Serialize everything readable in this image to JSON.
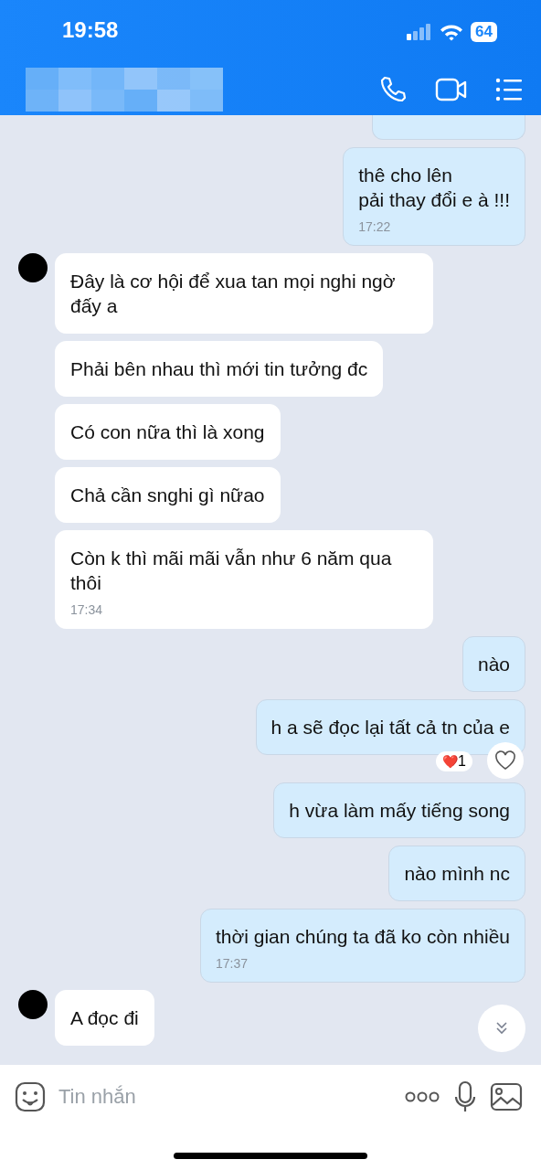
{
  "status_bar": {
    "time": "19:58",
    "battery": "64"
  },
  "header": {
    "name_blurred": true
  },
  "messages": [
    {
      "kind": "outgoing",
      "cut_off": true
    },
    {
      "kind": "outgoing",
      "text": "thê cho lên\npải thay đổi e à !!!",
      "time": "17:22"
    },
    {
      "kind": "incoming",
      "avatar": true,
      "text": "Đây là cơ hội để xua tan mọi nghi ngờ đấy a"
    },
    {
      "kind": "incoming",
      "avatar": false,
      "text": "Phải bên nhau thì mới tin tưởng đc"
    },
    {
      "kind": "incoming",
      "avatar": false,
      "text": "Có con nữa thì là xong"
    },
    {
      "kind": "incoming",
      "avatar": false,
      "text": "Chả cần snghi gì nữao"
    },
    {
      "kind": "incoming",
      "avatar": false,
      "text": "Còn k thì mãi mãi vẫn như 6 năm qua thôi",
      "time": "17:34"
    },
    {
      "kind": "outgoing",
      "text": "nào"
    },
    {
      "kind": "outgoing",
      "text": "h a sẽ đọc lại tất cả tn của e",
      "reaction": {
        "emoji": "❤️",
        "count": "1"
      }
    },
    {
      "kind": "outgoing",
      "text": "h vừa làm mấy tiếng song"
    },
    {
      "kind": "outgoing",
      "text": "nào mình nc"
    },
    {
      "kind": "outgoing",
      "text": "thời gian chúng ta đã ko còn nhiều",
      "time": "17:37"
    },
    {
      "kind": "incoming",
      "avatar": true,
      "text": "A đọc đi"
    }
  ],
  "composer": {
    "placeholder": "Tin nhắn"
  }
}
